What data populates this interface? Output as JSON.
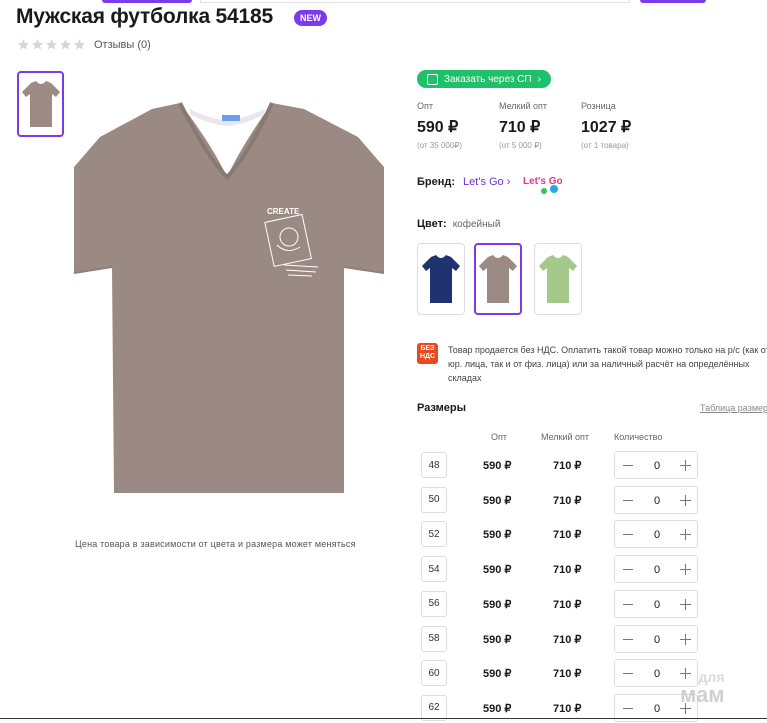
{
  "product": {
    "title": "Мужская футболка 54185",
    "badge": "NEW",
    "reviews": "Отзывы (0)",
    "price_note": "Цена товара в зависимости от цвета и размера может меняться"
  },
  "order_button": "Заказать через СП",
  "prices": [
    {
      "label": "Опт",
      "value": "590 ₽",
      "sub": "(от 35 000₽)"
    },
    {
      "label": "Мелкий опт",
      "value": "710 ₽",
      "sub": "(от 5 000 ₽)"
    },
    {
      "label": "Розница",
      "value": "1027 ₽",
      "sub": "(от 1 товара)"
    }
  ],
  "brand": {
    "label": "Бренд:",
    "value": "Let's Go",
    "logo_text": "Let's Go"
  },
  "color": {
    "label": "Цвет:",
    "value": "кофейный",
    "swatches": [
      {
        "name": "темно-синий",
        "color": "#1f3370"
      },
      {
        "name": "кофейный",
        "color": "#9c8a84"
      },
      {
        "name": "салатовый",
        "color": "#a4c98a"
      }
    ]
  },
  "vat": {
    "icon_text": "БЕЗ НДС",
    "text": "Товар продается без НДС. Оплатить такой товар можно только на р/с (как от юр. лица, так и от физ. лица) или за наличный расчёт на определённых складах"
  },
  "sizes": {
    "title": "Размеры",
    "table_link": "Таблица размеров",
    "headers": {
      "opt": "Опт",
      "small_opt": "Мелкий опт",
      "qty": "Количество"
    },
    "rows": [
      {
        "size": "48",
        "opt": "590 ₽",
        "small_opt": "710 ₽",
        "qty": "0"
      },
      {
        "size": "50",
        "opt": "590 ₽",
        "small_opt": "710 ₽",
        "qty": "0"
      },
      {
        "size": "52",
        "opt": "590 ₽",
        "small_opt": "710 ₽",
        "qty": "0"
      },
      {
        "size": "54",
        "opt": "590 ₽",
        "small_opt": "710 ₽",
        "qty": "0"
      },
      {
        "size": "56",
        "opt": "590 ₽",
        "small_opt": "710 ₽",
        "qty": "0"
      },
      {
        "size": "58",
        "opt": "590 ₽",
        "small_opt": "710 ₽",
        "qty": "0"
      },
      {
        "size": "60",
        "opt": "590 ₽",
        "small_opt": "710 ₽",
        "qty": "0"
      },
      {
        "size": "62",
        "opt": "590 ₽",
        "small_opt": "710 ₽",
        "qty": "0"
      }
    ]
  },
  "tshirt_print": "CREATE",
  "watermark": {
    "line1": "для",
    "line2": "мам"
  },
  "colors": {
    "accent": "#7c3aed",
    "green": "#20c06b",
    "shirt": "#9c8a84",
    "vat": "#e64a1e"
  }
}
